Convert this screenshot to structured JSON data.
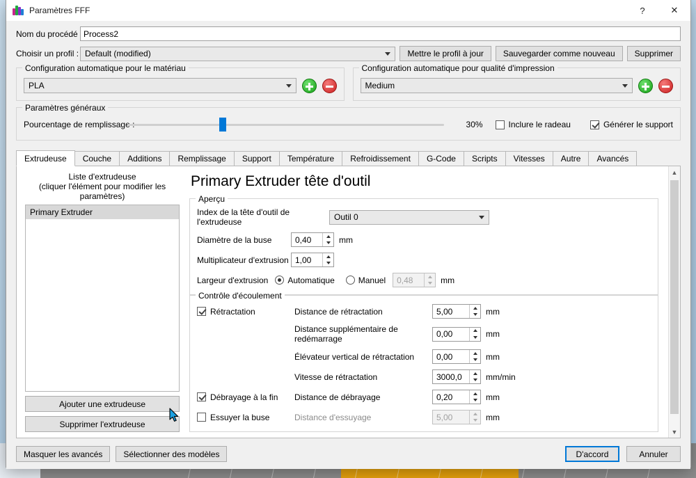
{
  "window": {
    "title": "Paramètres FFF",
    "app_icon": "simplify3d-logo-icon",
    "help_label": "?",
    "close_label": "✕"
  },
  "top": {
    "process_name_label": "Nom du procédé :",
    "process_name_value": "Process2",
    "process_name_placeholder": "",
    "profile_label": "Choisir un profil :",
    "profile_value": "Default (modified)",
    "update_profile_label": "Mettre le profil à jour",
    "save_as_new_label": "Sauvegarder comme nouveau",
    "delete_label": "Supprimer"
  },
  "autoconfig": {
    "material": {
      "title": "Configuration automatique pour le matériau",
      "value": "PLA",
      "add_label": "+",
      "remove_label": "−"
    },
    "quality": {
      "title": "Configuration automatique pour qualité d'impression",
      "value": "Medium",
      "add_label": "+",
      "remove_label": "−"
    }
  },
  "general": {
    "title": "Paramètres généraux",
    "infill_label": "Pourcentage de remplissage :",
    "infill_value": "30%",
    "infill_percent": 30,
    "raft_label": "Inclure le radeau",
    "raft_checked": false,
    "support_label": "Générer le support",
    "support_checked": true
  },
  "tabs": [
    {
      "label": "Extrudeuse",
      "active": true
    },
    {
      "label": "Couche",
      "active": false
    },
    {
      "label": "Additions",
      "active": false
    },
    {
      "label": "Remplissage",
      "active": false
    },
    {
      "label": "Support",
      "active": false
    },
    {
      "label": "Température",
      "active": false
    },
    {
      "label": "Refroidissement",
      "active": false
    },
    {
      "label": "G-Code",
      "active": false
    },
    {
      "label": "Scripts",
      "active": false
    },
    {
      "label": "Vitesses",
      "active": false
    },
    {
      "label": "Autre",
      "active": false
    },
    {
      "label": "Avancés",
      "active": false
    }
  ],
  "left_pane": {
    "caption_line1": "Liste d'extrudeuse",
    "caption_line2": "(cliquer l'élément pour modifier les paramètres)",
    "items": [
      "Primary Extruder"
    ],
    "add_button": "Ajouter une extrudeuse",
    "remove_button": "Supprimer l'extrudeuse"
  },
  "right_pane": {
    "title": "Primary Extruder tête d'outil",
    "overview": {
      "title": "Aperçu",
      "toolhead_index_label": "Index de la tête d'outil de l'extrudeuse",
      "toolhead_index_value": "Outil 0",
      "nozzle_diameter_label": "Diamètre de la buse",
      "nozzle_diameter_value": "0,40",
      "nozzle_diameter_unit": "mm",
      "extrusion_multiplier_label": "Multiplicateur d'extrusion",
      "extrusion_multiplier_value": "1,00",
      "extrusion_width_label": "Largeur d'extrusion",
      "extrusion_width_auto_label": "Automatique",
      "extrusion_width_auto_selected": true,
      "extrusion_width_manual_label": "Manuel",
      "extrusion_width_manual_value": "0,48",
      "extrusion_width_unit": "mm"
    },
    "flow": {
      "title": "Contrôle d'écoulement",
      "retraction_label": "Rétractation",
      "retraction_checked": true,
      "retract_distance_label": "Distance de rétractation",
      "retract_distance_value": "5,00",
      "retract_distance_unit": "mm",
      "extra_restart_label": "Distance supplémentaire de redémarrage",
      "extra_restart_value": "0,00",
      "extra_restart_unit": "mm",
      "vertical_lift_label": "Élévateur vertical de rétractation",
      "vertical_lift_value": "0,00",
      "vertical_lift_unit": "mm",
      "retract_speed_label": "Vitesse de rétractation",
      "retract_speed_value": "3000,0",
      "retract_speed_unit": "mm/min",
      "coast_label": "Débrayage à la fin",
      "coast_checked": true,
      "coast_distance_label": "Distance de débrayage",
      "coast_distance_value": "0,20",
      "coast_distance_unit": "mm",
      "wipe_label": "Essuyer la buse",
      "wipe_checked": false,
      "wipe_distance_label": "Distance d'essuyage",
      "wipe_distance_value": "5,00",
      "wipe_distance_unit": "mm"
    }
  },
  "footer": {
    "hide_advanced_label": "Masquer les avancés",
    "select_models_label": "Sélectionner des modèles",
    "ok_label": "D'accord",
    "cancel_label": "Annuler"
  },
  "colors": {
    "accent": "#0078d7",
    "add_green": "#18a218",
    "remove_red": "#cc1f1f",
    "bed_orange": "#e8a30c"
  }
}
